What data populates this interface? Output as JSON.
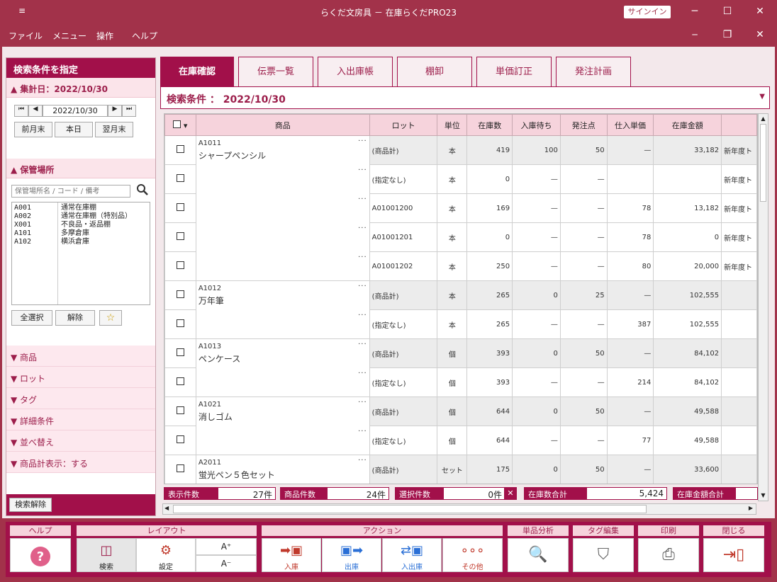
{
  "window": {
    "title": "らくだ文房具 － 在庫らくだPRO23",
    "signin": "サインイン",
    "min": "─",
    "max": "☐",
    "close": "✕",
    "restore": "❐",
    "menu_icon": "≡"
  },
  "menu": [
    "ファイル",
    "メニュー",
    "操作",
    "ヘルプ"
  ],
  "left": {
    "title": "検索条件を指定",
    "date_section": "集計日：2022/10/30",
    "date_value": "2022/10/30",
    "date_buttons": [
      "前月末",
      "本日",
      "翌月末"
    ],
    "nav": [
      "⏮",
      "◀",
      "▶",
      "⏭"
    ],
    "loc_section": "保管場所",
    "loc_placeholder": "保管場所名 / コード / 備考",
    "locations": [
      {
        "code": "A001",
        "name": "通常在庫棚"
      },
      {
        "code": "A002",
        "name": "通常在庫棚（特別品）"
      },
      {
        "code": "X001",
        "name": "不良品・返品棚"
      },
      {
        "code": "A101",
        "name": "多摩倉庫"
      },
      {
        "code": "A102",
        "name": "横浜倉庫"
      }
    ],
    "loc_buttons": [
      "全選択",
      "解除",
      "☆"
    ],
    "sections": [
      "商品",
      "ロット",
      "タグ",
      "詳細条件",
      "並べ替え",
      "商品計表示：する"
    ],
    "clear": "検索解除"
  },
  "tabs": [
    "在庫確認",
    "伝票一覧",
    "入出庫帳",
    "棚卸",
    "単価訂正",
    "発注計画"
  ],
  "condition": "検索条件 ： 2022/10/30",
  "table": {
    "headers": [
      "商品",
      "ロット",
      "単位",
      "在庫数",
      "入庫待ち",
      "発注点",
      "仕入単価",
      "在庫金額"
    ],
    "rows": [
      {
        "code": "A1011",
        "name": "シャープペンシル",
        "lot": "(商品計)",
        "unit": "本",
        "qty": "419",
        "wait": "100",
        "point": "50",
        "price": "—",
        "amount": "33,182",
        "note": "新年度ト",
        "gray": true
      },
      {
        "lot": "(指定なし)",
        "unit": "本",
        "qty": "0",
        "wait": "—",
        "point": "—",
        "price": "",
        "amount": "",
        "note": "新年度ト"
      },
      {
        "lot": "A01001200",
        "unit": "本",
        "qty": "169",
        "wait": "—",
        "point": "—",
        "price": "78",
        "amount": "13,182",
        "note": "新年度ト"
      },
      {
        "lot": "A01001201",
        "unit": "本",
        "qty": "0",
        "wait": "—",
        "point": "—",
        "price": "78",
        "amount": "0",
        "note": "新年度ト"
      },
      {
        "lot": "A01001202",
        "unit": "本",
        "qty": "250",
        "wait": "—",
        "point": "—",
        "price": "80",
        "amount": "20,000",
        "note": "新年度ト"
      },
      {
        "code": "A1012",
        "name": "万年筆",
        "lot": "(商品計)",
        "unit": "本",
        "qty": "265",
        "wait": "0",
        "point": "25",
        "price": "—",
        "amount": "102,555",
        "note": "",
        "gray": true
      },
      {
        "lot": "(指定なし)",
        "unit": "本",
        "qty": "265",
        "wait": "—",
        "point": "—",
        "price": "387",
        "amount": "102,555",
        "note": ""
      },
      {
        "code": "A1013",
        "name": "ペンケース",
        "lot": "(商品計)",
        "unit": "個",
        "qty": "393",
        "wait": "0",
        "point": "50",
        "price": "—",
        "amount": "84,102",
        "note": "",
        "gray": true
      },
      {
        "lot": "(指定なし)",
        "unit": "個",
        "qty": "393",
        "wait": "—",
        "point": "—",
        "price": "214",
        "amount": "84,102",
        "note": ""
      },
      {
        "code": "A1021",
        "name": "消しゴム",
        "lot": "(商品計)",
        "unit": "個",
        "qty": "644",
        "wait": "0",
        "point": "50",
        "price": "—",
        "amount": "49,588",
        "note": "",
        "gray": true
      },
      {
        "lot": "(指定なし)",
        "unit": "個",
        "qty": "644",
        "wait": "—",
        "point": "—",
        "price": "77",
        "amount": "49,588",
        "note": ""
      },
      {
        "code": "A2011",
        "name": "蛍光ペン５色セット",
        "lot": "(商品計)",
        "unit": "セット",
        "qty": "175",
        "wait": "0",
        "point": "50",
        "price": "—",
        "amount": "33,600",
        "note": "",
        "gray": true
      }
    ]
  },
  "status": {
    "display_label": "表示件数",
    "display_value": "27件",
    "items_label": "商品件数",
    "items_value": "24件",
    "selected_label": "選択件数",
    "selected_value": "0件",
    "qty_label": "在庫数合計",
    "qty_value": "5,424",
    "amount_label": "在庫金額合計"
  },
  "bottom": {
    "help": "ヘルプ",
    "layout": "レイアウト",
    "search": "検索",
    "settings": "設定",
    "font_up": "A⁺",
    "font_down": "A⁻",
    "action": "アクション",
    "in": "入庫",
    "out": "出庫",
    "inout": "入出庫",
    "other": "その他",
    "analysis": "単品分析",
    "tag": "タグ編集",
    "print": "印刷",
    "close": "閉じる"
  },
  "colors": {
    "brand": "#a2104a",
    "title": "#a2324a"
  }
}
